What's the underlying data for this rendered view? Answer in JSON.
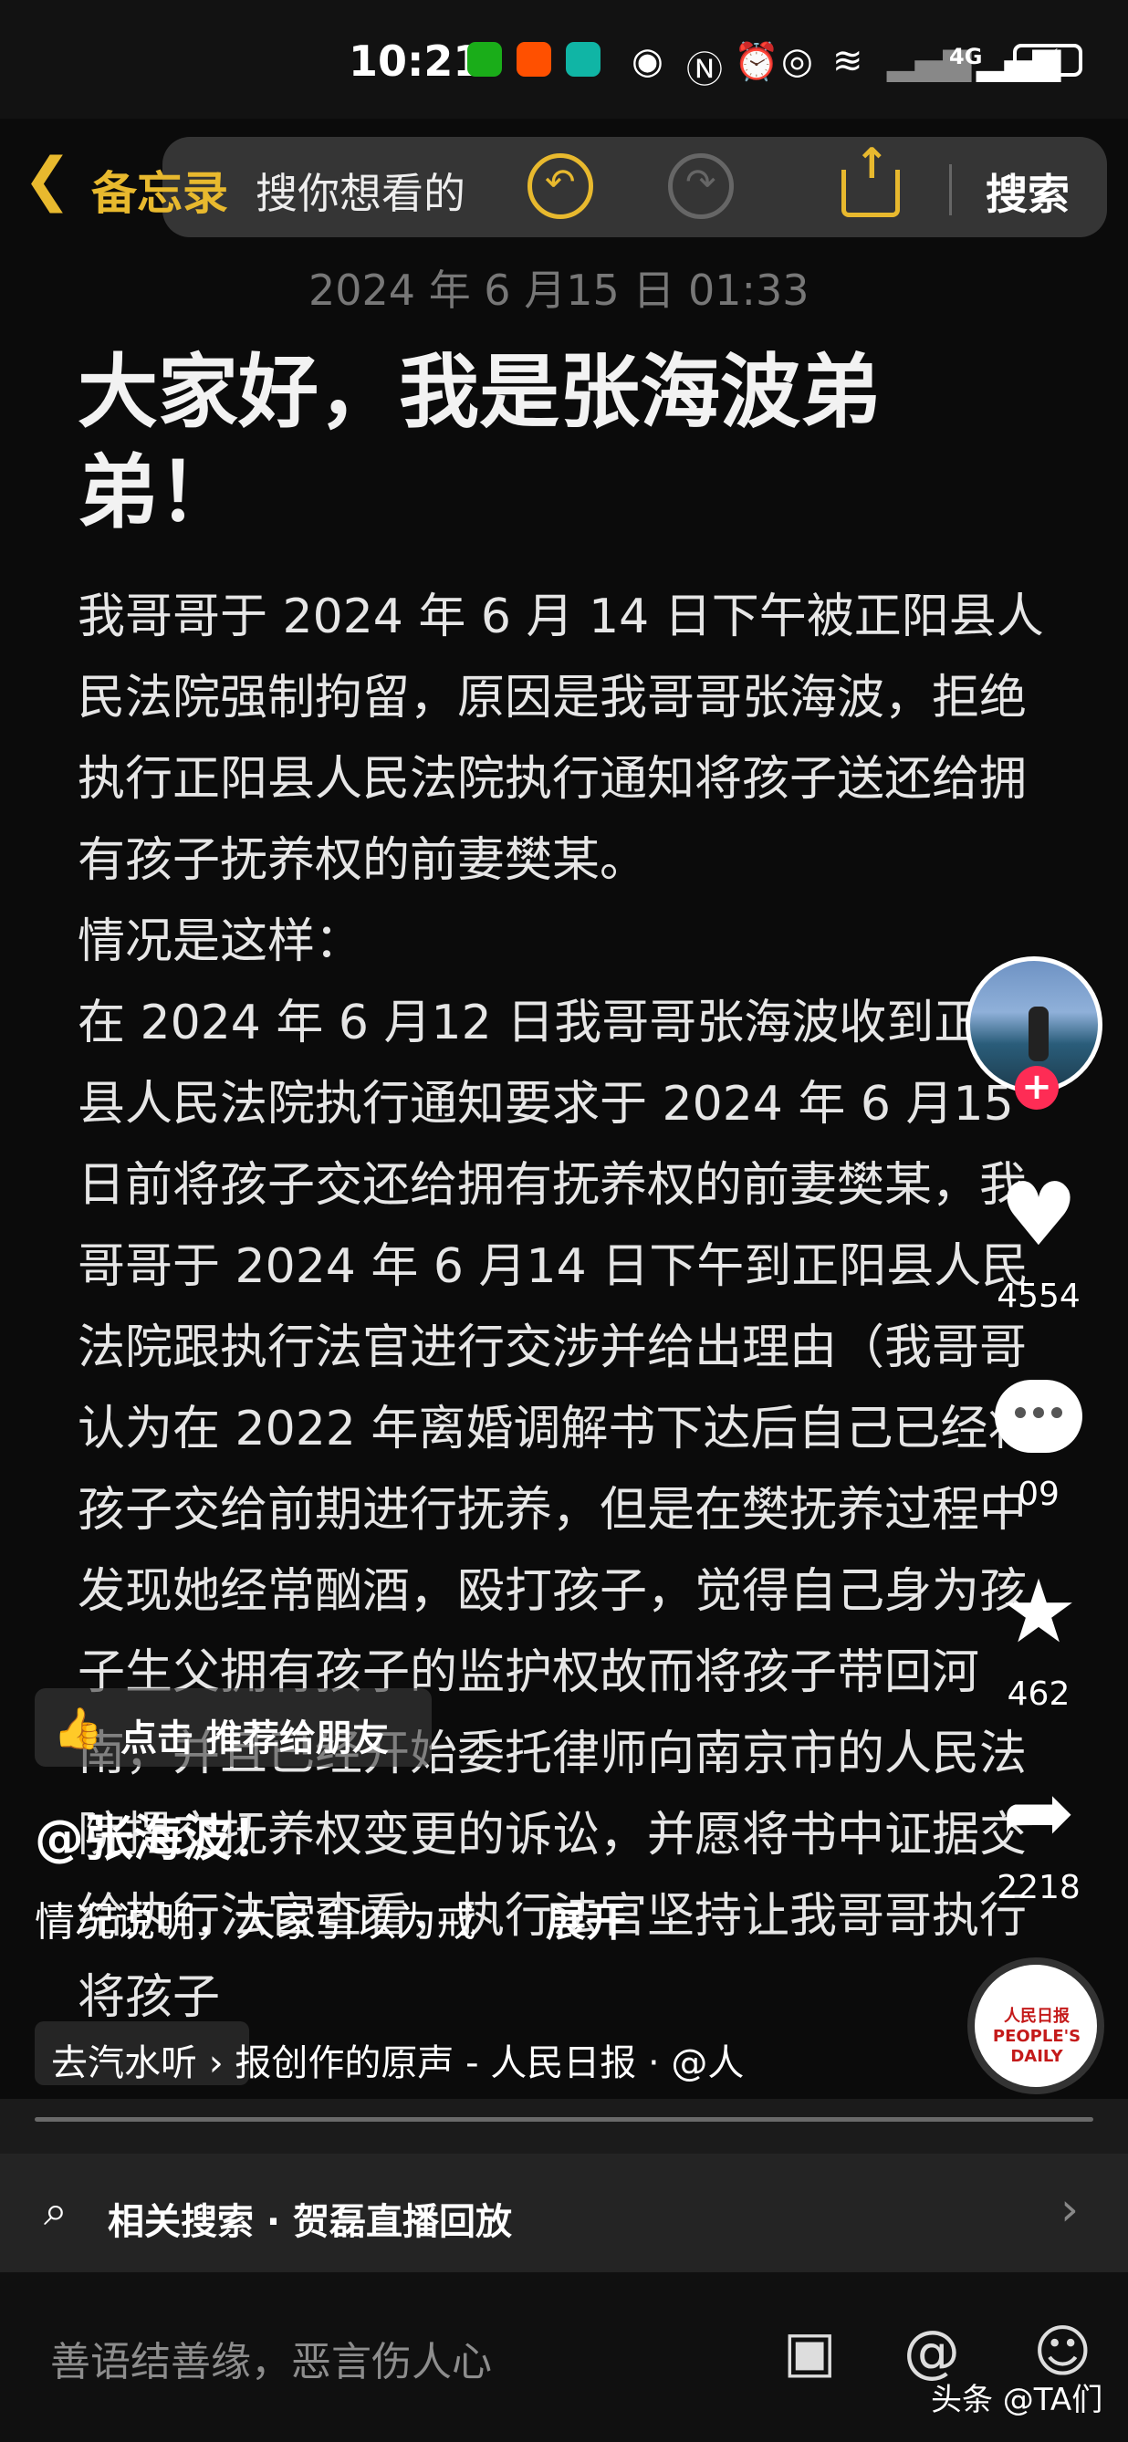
{
  "status_bar": {
    "time": "10:21",
    "network_label": "4G",
    "icons": [
      "wechat-icon",
      "taobao-icon",
      "home-app-icon",
      "eye-icon",
      "nfc-icon",
      "alarm-icon",
      "hotspot-icon",
      "wifi-icon",
      "signal-icon",
      "battery-charging-icon"
    ]
  },
  "notes_app": {
    "back_label": "备忘录",
    "search_placeholder": "搜你想看的",
    "search_button": "搜索",
    "date": "2024 年 6 月15 日 01:33",
    "title": "大家好，我是张海波弟弟！",
    "body": "我哥哥于 2024 年 6 月 14 日下午被正阳县人民法院强制拘留，原因是我哥哥张海波，拒绝执行正阳县人民法院执行通知将孩子送还给拥有孩子抚养权的前妻樊某。\n情况是这样：\n在 2024 年 6 月12 日我哥哥张海波收到正阳县人民法院执行通知要求于 2024 年 6 月15 日前将孩子交还给拥有抚养权的前妻樊某，我哥哥于 2024 年 6 月14 日下午到正阳县人民法院跟执行法官进行交涉并给出理由（我哥哥认为在 2022 年离婚调解书下达后自己已经将孩子交给前期进行抚养，但是在樊抚养过程中发现她经常酗酒，殴打孩子，觉得自己身为孩子生父拥有孩子的监护权故而将孩子带回河南，并且已经开始委托律师向南京市的人民法院提交抚养权变更的诉讼，并愿将书中证据交给执行法官查看，执行法官坚持让我哥哥执行将孩子"
  },
  "video_overlay": {
    "recommend_label": "点击 推荐给朋友",
    "author": "@张海波！",
    "description": "情况说明，大家引以为戒",
    "expand_label": "展开",
    "music_text": "去汽水听 › 报创作的原声 - 人民日报 · @人",
    "related_search": "相关搜索 · 贺磊直播回放",
    "comment_placeholder": "善语结善缘，恶言伤人心",
    "watermark": "头条 @TA们"
  },
  "right_rail": {
    "like_count": "4554",
    "comment_count": "09",
    "favorite_count": "462",
    "share_count": "2218",
    "music_disc_text": "人民日报 PEOPLE'S DAILY"
  },
  "colors": {
    "accent": "#e8b92e",
    "follow_red": "#fe2c55",
    "background": "#0b0b0b"
  }
}
